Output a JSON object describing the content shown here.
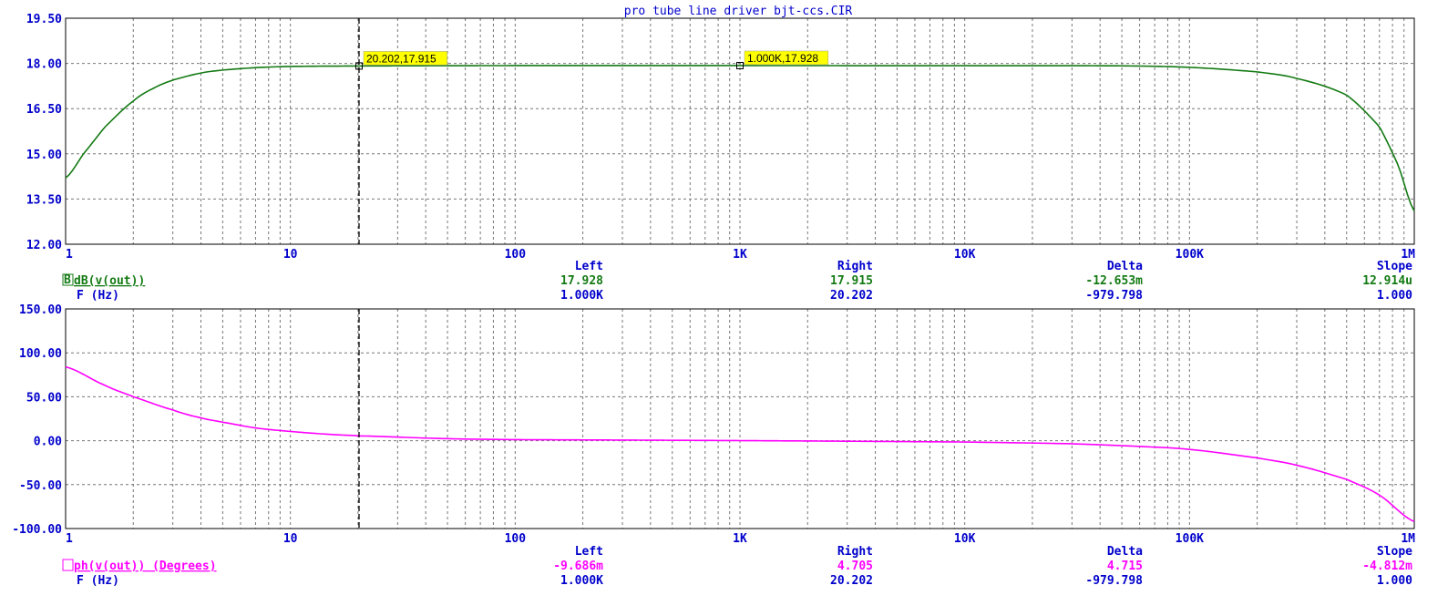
{
  "title": "pro tube line driver bjt-ccs.CIR",
  "colors": {
    "axis_text": "#0000cc",
    "gain": "#137a13",
    "phase": "#ff00ff",
    "marker_bg": "#ffff00",
    "cursor": "#000000"
  },
  "chart_data": [
    {
      "type": "line",
      "x_scale": "log",
      "xlim": [
        1,
        1000000
      ],
      "ylim": [
        12,
        19.5
      ],
      "yticks": [
        "19.50",
        "18.00",
        "16.50",
        "15.00",
        "13.50",
        "12.00"
      ],
      "xticks": [
        "1",
        "10",
        "100",
        "1K",
        "10K",
        "100K",
        "1M"
      ],
      "grid": true,
      "series": [
        {
          "name": "dB(v(out))",
          "x": [
            1,
            1.2,
            1.5,
            2,
            2.5,
            3,
            4,
            5,
            7,
            10,
            20,
            50,
            100,
            1000,
            10000,
            50000,
            100000,
            200000,
            300000,
            500000,
            700000,
            850000,
            1000000
          ],
          "y": [
            14.2,
            15.0,
            15.9,
            16.75,
            17.2,
            17.45,
            17.68,
            17.78,
            17.86,
            17.9,
            17.915,
            17.925,
            17.928,
            17.928,
            17.925,
            17.92,
            17.87,
            17.72,
            17.5,
            16.95,
            15.9,
            14.6,
            13.1
          ]
        }
      ],
      "markers": [
        {
          "x": 20.202,
          "y": 17.915,
          "label": "20.202,17.915"
        },
        {
          "x": 1000,
          "y": 17.928,
          "label": "1.000K,17.928"
        }
      ],
      "cursor_x": 20.202,
      "readout": {
        "headers": [
          "Left",
          "Right",
          "Delta",
          "Slope"
        ],
        "rows": [
          {
            "label": "B",
            "name": "dB(v(out))",
            "values": [
              "17.928",
              "17.915",
              "-12.653m",
              "12.914u"
            ]
          },
          {
            "label": "",
            "name": "F (Hz)",
            "values": [
              "1.000K",
              "20.202",
              "-979.798",
              "1.000"
            ]
          }
        ]
      }
    },
    {
      "type": "line",
      "x_scale": "log",
      "xlim": [
        1,
        1000000
      ],
      "ylim": [
        -100,
        150
      ],
      "yticks": [
        "150.00",
        "100.00",
        "50.00",
        "0.00",
        "-50.00",
        "-100.00"
      ],
      "xticks": [
        "1",
        "10",
        "100",
        "1K",
        "10K",
        "100K",
        "1M"
      ],
      "grid": true,
      "series": [
        {
          "name": "ph(v(out)) (Degrees)",
          "x": [
            1,
            1.5,
            2,
            3,
            4,
            5,
            7,
            10,
            15,
            20.202,
            50,
            100,
            1000,
            10000,
            30000,
            60000,
            100000,
            200000,
            300000,
            500000,
            700000,
            1000000
          ],
          "y": [
            84,
            63,
            50,
            35,
            26,
            21,
            14.5,
            10.5,
            7.2,
            5.5,
            2.3,
            1.2,
            0.1,
            -1.5,
            -3.5,
            -6.5,
            -10,
            -19.5,
            -28,
            -44,
            -62,
            -92
          ]
        }
      ],
      "cursor_x": 20.202,
      "readout": {
        "headers": [
          "Left",
          "Right",
          "Delta",
          "Slope"
        ],
        "rows": [
          {
            "label": "",
            "name": "ph(v(out)) (Degrees)",
            "values": [
              "-9.686m",
              "4.705",
              "4.715",
              "-4.812m"
            ]
          },
          {
            "label": "",
            "name": "F (Hz)",
            "values": [
              "1.000K",
              "20.202",
              "-979.798",
              "1.000"
            ]
          }
        ]
      }
    }
  ]
}
